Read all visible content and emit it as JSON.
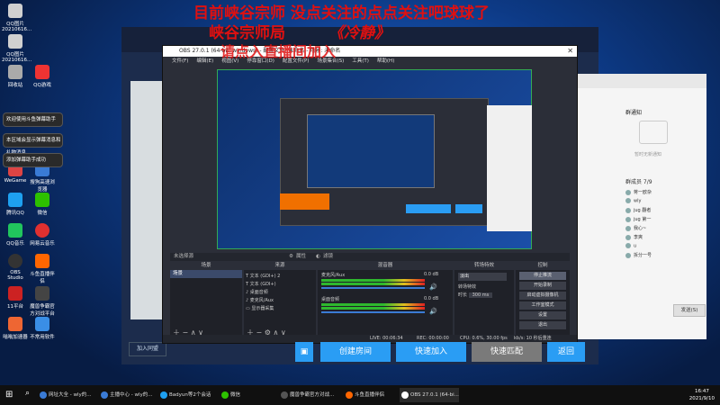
{
  "overlay": {
    "line1": "目前峡谷宗师    没点关注的点点关注吧球球了",
    "line2_left": "峡谷宗师局",
    "line2_right": "《冷静》",
    "line3": "请点入直播间加入"
  },
  "desktop_icons": [
    {
      "label": "QQ图片20210616...",
      "color": "#d0d0d0"
    },
    {
      "label": "QQ图片20210616...",
      "color": "#d0d0d0"
    },
    {
      "label": "回收站",
      "color": "#aaa"
    },
    {
      "label": "QQ游戏",
      "color": "#e33"
    },
    {
      "label": "WeGame",
      "color": "#d44"
    },
    {
      "label": "腾讯QQ",
      "color": "#1ea0f0"
    },
    {
      "label": "QQ音乐",
      "color": "#21c55d"
    },
    {
      "label": "OBS Studio",
      "color": "#333"
    },
    {
      "label": "11平台",
      "color": "#c22"
    },
    {
      "label": "嗡嗡加速器",
      "color": "#e63"
    }
  ],
  "desktop_icons_col2": [
    {
      "label": "搜狗高速浏览器",
      "color": "#3a7bd5"
    },
    {
      "label": "微信",
      "color": "#2dc100"
    },
    {
      "label": "网易云音乐",
      "color": "#e03030"
    },
    {
      "label": "斗鱼直播伴侣",
      "color": "#f60"
    },
    {
      "label": "魔兽争霸官方对战平台",
      "color": "#444"
    },
    {
      "label": "不常用软件",
      "color": "#3a8ee6"
    }
  ],
  "tooltips": [
    "欢迎使用斗鱼弹幕助手",
    "本区域会显示弹幕消息和礼物消息",
    "添加弹幕助手成功"
  ],
  "obs": {
    "title": "OBS 27.0.1 (64-bit, windows) - 配置文件: 未命名 - 场景: 未命名",
    "menu": [
      "文件(F)",
      "编辑(E)",
      "视图(V)",
      "停靠窗口(D)",
      "配置文件(P)",
      "场景集合(S)",
      "工具(T)",
      "帮助(H)"
    ],
    "no_source": "未选择源",
    "props_btn": "属性",
    "filter_btn": "滤镜",
    "docks": {
      "scenes": "场景",
      "sources": "来源",
      "mixer": "混音器",
      "transitions": "转场特效",
      "controls": "控制"
    },
    "scene_item": "场景",
    "sources": [
      "文本 (GDI+) 2",
      "文本 (GDI+)",
      "桌面音频",
      "麦克风/Aux",
      "显示器采集"
    ],
    "mixer_channels": [
      "麦克风/Aux",
      "桌面音频"
    ],
    "mixer_db": [
      "0.0 dB",
      "0.0 dB"
    ],
    "transition_type": "淡出",
    "duration_label": "时长",
    "duration_value": "300 ms",
    "controls": [
      "停止推流",
      "开始录制",
      "启动虚拟摄像机",
      "工作室模式",
      "设置",
      "退出"
    ],
    "status": {
      "live": "LIVE: 00:06:34",
      "rec": "REC: 00:00:00",
      "cpu": "CPU: 0.6%, 30.00 fps",
      "kbps": "kb/s: 10 秒后重连"
    }
  },
  "qq": {
    "notice": "群通知",
    "no_notice": "暂时无新通知",
    "group_count": "群成员 7/9",
    "members": [
      "蒋一欧杂",
      "wly",
      "jug 翻者",
      "jug 第一",
      "我心~",
      "李爽",
      "u",
      "拆分一号"
    ],
    "send": "发送(S)"
  },
  "bottom_buttons": {
    "create_room": "创建房间",
    "quick_join": "快速加入",
    "quick_match": "快速匹配",
    "back": "返回"
  },
  "back_window": {
    "join_ally": "加入同盟",
    "room_item": "加入聊天室"
  },
  "taskbar": {
    "items": [
      "网址大全 - wly的...",
      "主播中心 - wly的...",
      "Badyun等2个会话",
      "微信",
      "魔兽争霸官方对战...",
      "斗鱼直播伴侣",
      "OBS 27.0.1 (64-bi..."
    ],
    "time": "16:47",
    "date": "2021/9/10"
  }
}
